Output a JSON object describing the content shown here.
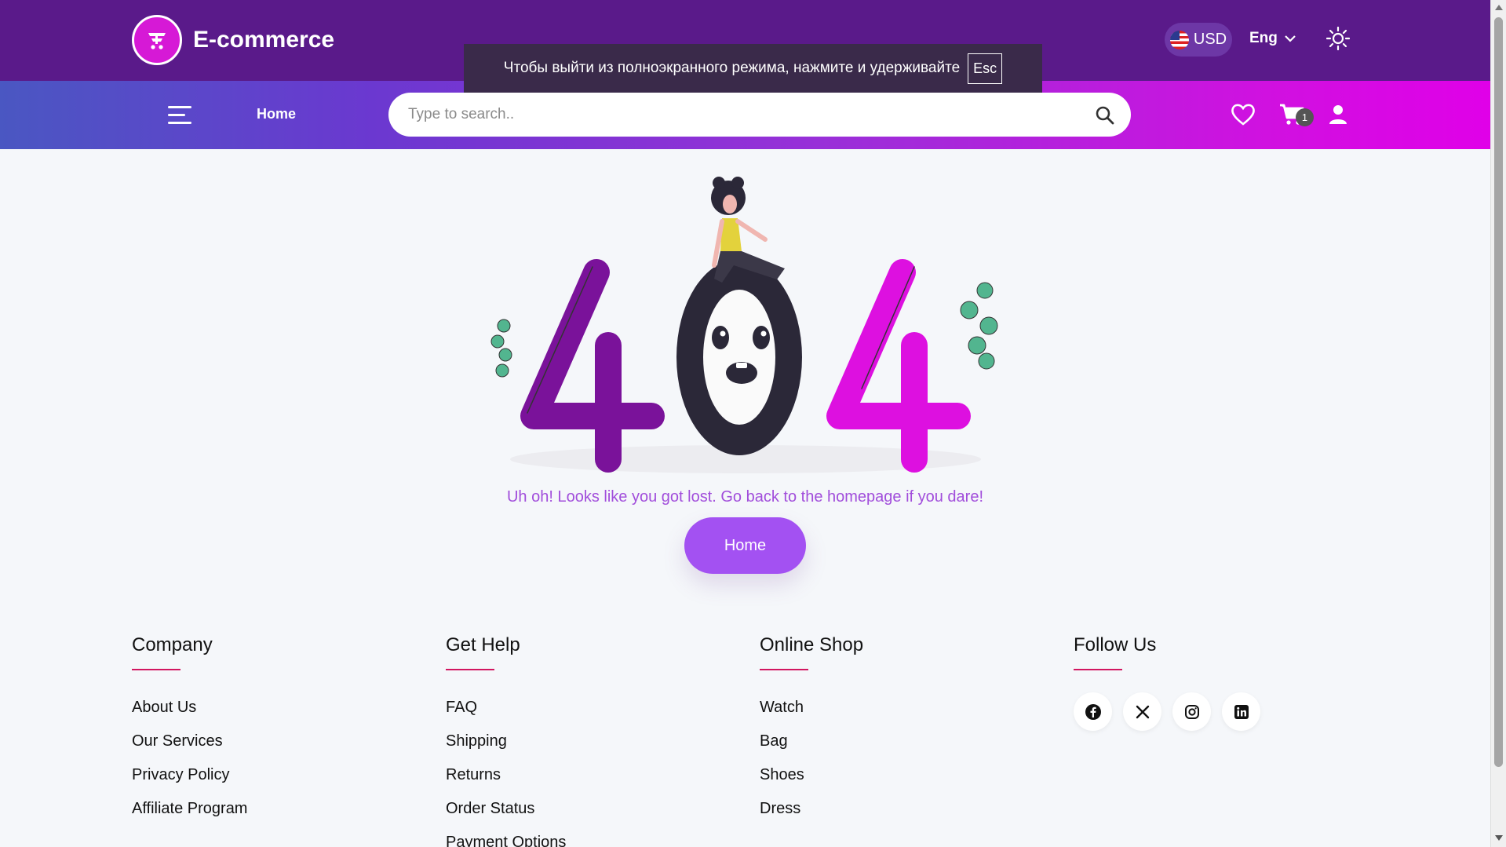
{
  "header": {
    "brand": "E-commerce",
    "currency": "USD",
    "language": "Eng"
  },
  "fullscreen_notice": {
    "text": "Чтобы выйти из полноэкранного режима, нажмите и удерживайте",
    "key": "Esc"
  },
  "nav": {
    "home": "Home",
    "search_placeholder": "Type to search..",
    "cart_count": "1"
  },
  "error_page": {
    "message": "Uh oh! Looks like you got lost. Go back to the homepage if you dare!",
    "home_button": "Home"
  },
  "footer": {
    "columns": [
      {
        "title": "Company",
        "links": [
          "About Us",
          "Our Services",
          "Privacy Policy",
          "Affiliate Program"
        ]
      },
      {
        "title": "Get Help",
        "links": [
          "FAQ",
          "Shipping",
          "Returns",
          "Order Status",
          "Payment Options"
        ]
      },
      {
        "title": "Online Shop",
        "links": [
          "Watch",
          "Bag",
          "Shoes",
          "Dress"
        ]
      },
      {
        "title": "Follow Us",
        "socials": [
          "facebook-icon",
          "x-icon",
          "instagram-icon",
          "linkedin-icon"
        ]
      }
    ]
  },
  "colors": {
    "header_bg": "#5a1a8a",
    "accent_pink": "#d619d6",
    "button_purple": "#a351f2",
    "message_purple": "#a14ddb",
    "footer_underline": "#d21660"
  }
}
